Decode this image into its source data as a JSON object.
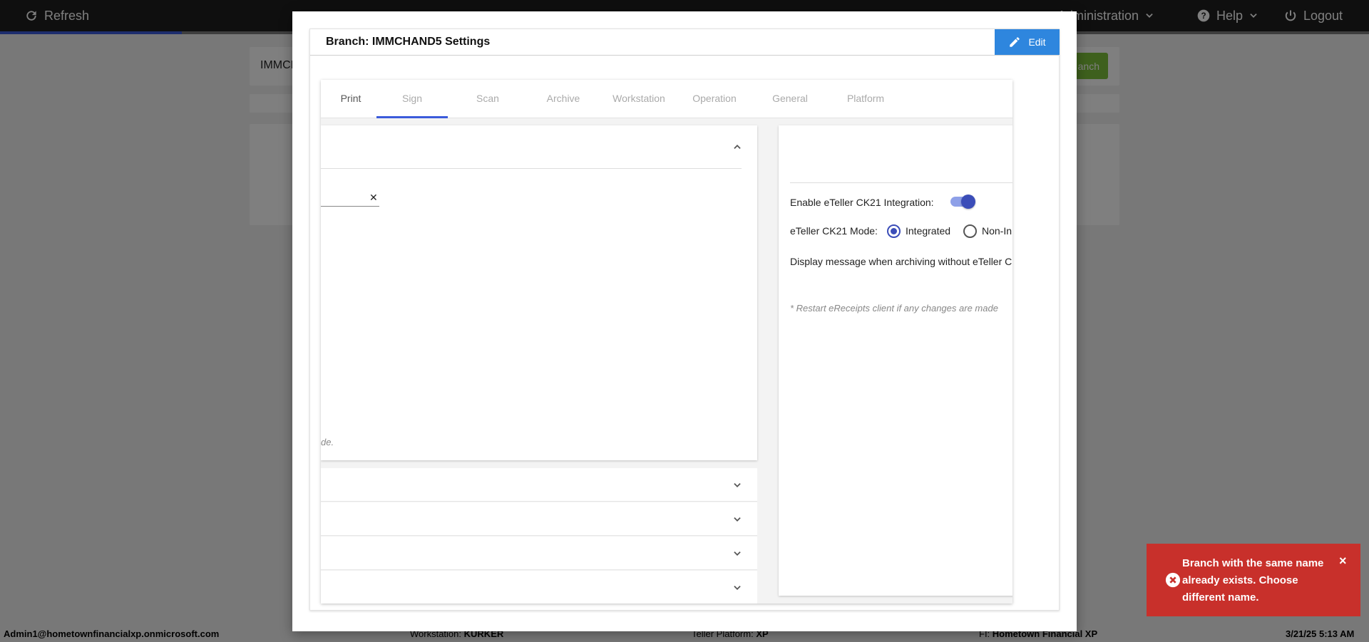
{
  "topbar": {
    "refresh_label": "Refresh",
    "administration_label": "Administration",
    "help_label": "Help",
    "logout_label": "Logout"
  },
  "background": {
    "search_value": "IMMCH",
    "add_branch_label": "anch"
  },
  "modal": {
    "title": "Branch: IMMCHAND5 Settings",
    "edit_label": "Edit",
    "tabs": [
      {
        "label": "Print"
      },
      {
        "label": "Sign"
      },
      {
        "label": "Scan"
      },
      {
        "label": "Archive"
      },
      {
        "label": "Workstation"
      },
      {
        "label": "Operation"
      },
      {
        "label": "General"
      },
      {
        "label": "Platform"
      }
    ],
    "active_tab": "Sign",
    "left_panel": {
      "clear_symbol": "✕",
      "note": "de."
    },
    "right_panel": {
      "enable_label": "Enable eTeller CK21 Integration:",
      "enable_value": true,
      "mode_label": "eTeller CK21 Mode:",
      "mode_options": [
        "Integrated",
        "Non-In"
      ],
      "mode_selected": "Integrated",
      "display_message_label": "Display message when archiving without eTeller C",
      "restart_note": "* Restart eReceipts client if any changes are made"
    }
  },
  "toast": {
    "message": "Branch with the same name already exists. Choose different name.",
    "close_symbol": "×"
  },
  "statusbar": {
    "user": "Admin1@hometownfinancialxp.onmicrosoft.com",
    "workstation_label": "Workstation:",
    "workstation_value": "KURKER",
    "platform_label": "Teller Platform:",
    "platform_value": "XP",
    "fi_label": "FI:",
    "fi_value": "Hometown Financial XP",
    "datetime": "3/21/25 5:13 AM"
  },
  "colors": {
    "accent": "#3b5bdb",
    "edit_button": "#2e86de",
    "toast_error": "#c8302b",
    "add_branch": "#7cc13a"
  }
}
